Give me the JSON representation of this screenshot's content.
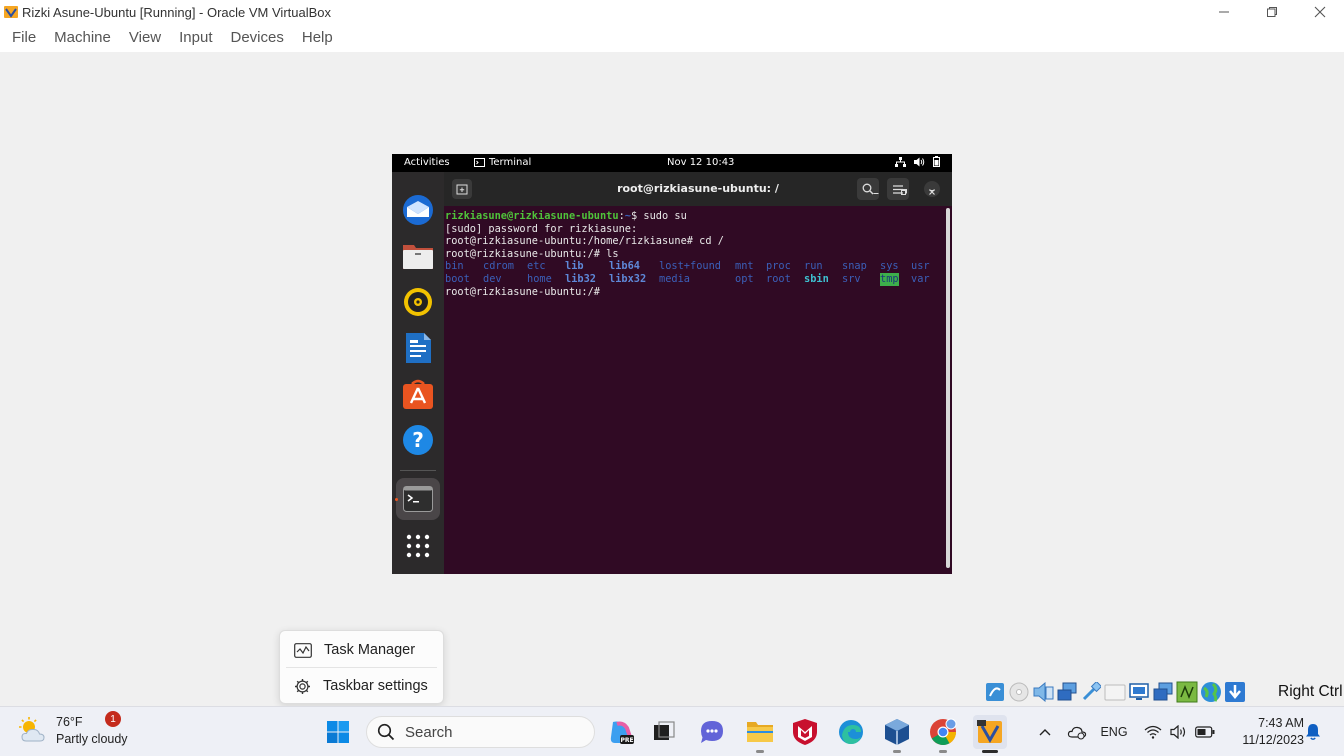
{
  "window": {
    "title": "Rizki Asune-Ubuntu [Running] - Oracle VM VirtualBox",
    "icon": "virtualbox-icon",
    "controls": [
      "minimize-icon",
      "restore-icon",
      "close-icon"
    ]
  },
  "menubar": {
    "items": [
      "File",
      "Machine",
      "View",
      "Input",
      "Devices",
      "Help"
    ]
  },
  "vm": {
    "topbar": {
      "activities": "Activities",
      "app_name": "Terminal",
      "datetime": "Nov 12  10:43",
      "system_icons": [
        "network-icon",
        "volume-icon",
        "battery-icon"
      ]
    },
    "dock": {
      "apps": [
        "thunderbird-icon",
        "files-icon",
        "rhythmbox-icon",
        "libreoffice-writer-icon",
        "app-center-icon",
        "help-icon",
        "terminal-icon",
        "show-apps-icon"
      ]
    },
    "terminal": {
      "title": "root@rizkiasune-ubuntu: /",
      "lines": {
        "l1_user": "rizkiasune@rizkiasune-ubuntu",
        "l1_sep": ":",
        "l1_path": "~",
        "l1_cmd": "$ sudo su",
        "l2": "[sudo] password for rizkiasune:",
        "l3": "root@rizkiasune-ubuntu:/home/rizkiasune# cd /",
        "l4": "root@rizkiasune-ubuntu:/# ls",
        "l7": "root@rizkiasune-ubuntu:/# "
      },
      "ls_row1": [
        "bin",
        "cdrom",
        "etc",
        "lib",
        "lib64",
        "lost+found",
        "mnt",
        "proc",
        "run",
        "snap",
        "sys",
        "usr"
      ],
      "ls_row2": [
        "boot",
        "dev",
        "home",
        "lib32",
        "libx32",
        "media",
        "opt",
        "root",
        "sbin",
        "srv",
        "tmp",
        "var"
      ]
    }
  },
  "context_menu": {
    "items": [
      {
        "label": "Task Manager",
        "icon": "task-manager-icon"
      },
      {
        "label": "Taskbar settings",
        "icon": "gear-icon"
      }
    ]
  },
  "vbox_status": {
    "icons": [
      "optical-drive-icon",
      "disc-icon",
      "audio-icon",
      "network-adapter-icon",
      "usb-icon",
      "shared-folder-icon",
      "display-icon",
      "recording-icon",
      "clipboard-icon",
      "globe-icon",
      "arrow-down-icon"
    ],
    "host_key": "Right Ctrl"
  },
  "taskbar": {
    "weather": {
      "temp": "76°F",
      "condition": "Partly cloudy",
      "badge": "1"
    },
    "search_placeholder": "Search",
    "apps": [
      "windows-start-icon",
      "copilot-icon",
      "task-view-icon",
      "teams-chat-icon",
      "file-explorer-icon",
      "mcafee-icon",
      "edge-icon",
      "virtualbox-taskbar-icon",
      "chrome-icon",
      "virtualbox-vm-icon"
    ],
    "tray": {
      "language": "ENG"
    },
    "clock": {
      "time": "7:43 AM",
      "date": "11/12/2023"
    }
  },
  "colors": {
    "terminal_bg": "#300a24",
    "prompt_green": "#4fc33a",
    "dir_blue": "#3b5fb8",
    "accent_windows": "#0067c0"
  }
}
